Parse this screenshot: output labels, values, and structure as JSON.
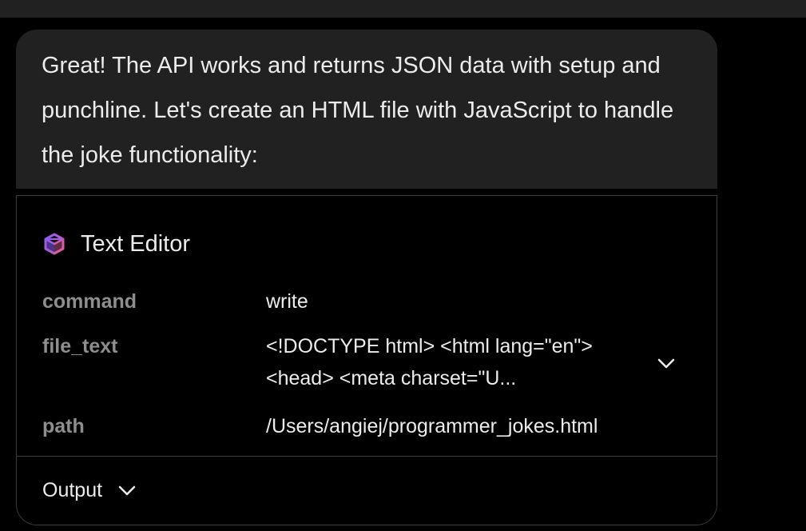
{
  "message": {
    "text": "Great! The API works and returns JSON data with setup and punchline. Let's create an HTML file with JavaScript to handle the joke functionality:"
  },
  "tool": {
    "title": "Text Editor",
    "icon": "cube-icon",
    "params": [
      {
        "key": "command",
        "value": "write"
      },
      {
        "key": "file_text",
        "value": "<!DOCTYPE html> <html lang=\"en\"> <head> <meta charset=\"U..."
      },
      {
        "key": "path",
        "value": "/Users/angiej/programmer_jokes.html"
      }
    ],
    "output_label": "Output"
  },
  "colors": {
    "background": "#000000",
    "message_bg": "#212121",
    "border": "#3d3d42",
    "key_text": "#8e8e8e",
    "icon_purple": "#8b5cf6",
    "icon_pink": "#e0609a"
  }
}
